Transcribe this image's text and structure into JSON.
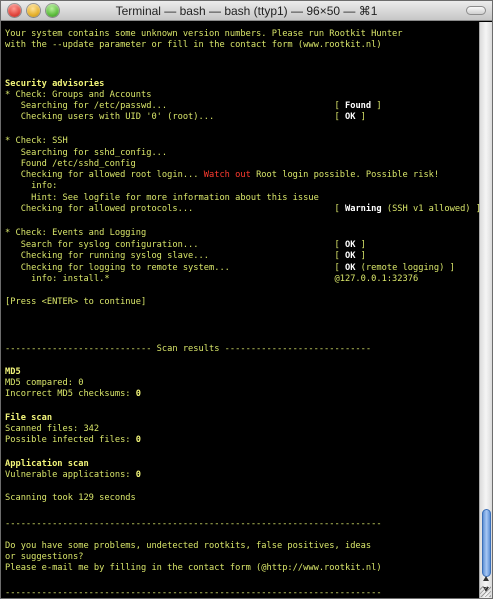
{
  "window": {
    "title": "Terminal — bash — bash (ttyp1) — 96×50 — ⌘1"
  },
  "terminal": {
    "lines": {
      "l1": "Your system contains some unknown version numbers. Please run Rootkit Hunter",
      "l2": "with the --update parameter or fill in the contact form (www.rootkit.nl)",
      "l3": "Security advisories",
      "l4": "* Check: Groups and Accounts",
      "l5a": "   Searching for /etc/passwd...                                [ ",
      "l5b": "Found",
      "l5c": " ]",
      "l6a": "   Checking users with UID '0' (root)...                       [ ",
      "l6b": "OK",
      "l6c": " ]",
      "l7": "* Check: SSH",
      "l8": "   Searching for sshd_config...",
      "l9": "   Found /etc/sshd_config",
      "l10a": "   Checking for allowed root login... ",
      "l10b": "Watch out",
      "l10c": " Root login possible. Possible risk!",
      "l11": "     info:",
      "l12": "     Hint: See logfile for more information about this issue",
      "l13a": "   Checking for allowed protocols...                           [ ",
      "l13b": "Warning",
      "l13c": " (SSH v1 allowed) ]",
      "l14": "* Check: Events and Logging",
      "l15a": "   Search for syslog configuration...                          [ ",
      "l15b": "OK",
      "l15c": " ]",
      "l16a": "   Checking for running syslog slave...                        [ ",
      "l16b": "OK",
      "l16c": " ]",
      "l17a": "   Checking for logging to remote system...                    [ ",
      "l17b": "OK",
      "l17c": " (remote logging) ]",
      "l18": "     info: install.*                                           @127.0.0.1:32376",
      "l19": "[Press <ENTER> to continue]",
      "l20": "---------------------------- Scan results ----------------------------",
      "l21": "MD5",
      "l22a": "MD5 compared: ",
      "l22b": "0",
      "l23a": "Incorrect MD5 checksums: ",
      "l23b": "0",
      "l24": "File scan",
      "l25": "Scanned files: 342",
      "l26a": "Possible infected files: ",
      "l26b": "0",
      "l27": "Application scan",
      "l28a": "Vulnerable applications: ",
      "l28b": "0",
      "l29": "Scanning took 129 seconds",
      "l30": "------------------------------------------------------------------------",
      "l31": "Do you have some problems, undetected rootkits, false positives, ideas",
      "l32": "or suggestions?",
      "l33": "Please e-mail me by filling in the contact form (@http://www.rootkit.nl)",
      "l34": "------------------------------------------------------------------------"
    }
  }
}
